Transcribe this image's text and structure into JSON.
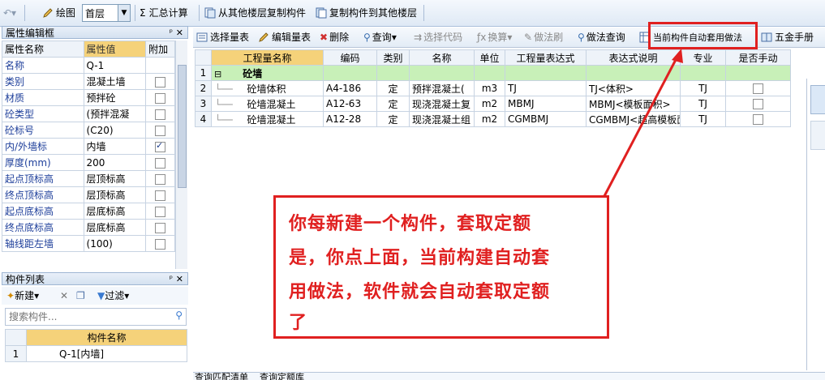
{
  "toolbar": {
    "draw_label": "绘图",
    "floor_value": "首层",
    "sum_label": "汇总计算",
    "copy_from_label": "从其他楼层复制构件",
    "copy_to_label": "复制构件到其他楼层"
  },
  "prop_panel": {
    "title": "属性编辑框",
    "headers": [
      "属性名称",
      "属性值",
      "附加"
    ],
    "rows": [
      {
        "name": "名称",
        "value": "Q-1",
        "has_check": false,
        "checked": false
      },
      {
        "name": "类别",
        "value": "混凝土墙",
        "has_check": true,
        "checked": false
      },
      {
        "name": "材质",
        "value": "预拌砼",
        "has_check": true,
        "checked": false
      },
      {
        "name": "砼类型",
        "value": "(预拌混凝",
        "has_check": true,
        "checked": false
      },
      {
        "name": "砼标号",
        "value": "(C20)",
        "has_check": true,
        "checked": false
      },
      {
        "name": "内/外墙标",
        "value": "内墙",
        "has_check": true,
        "checked": true
      },
      {
        "name": "厚度(mm)",
        "value": "200",
        "has_check": true,
        "checked": false
      },
      {
        "name": "起点顶标高",
        "value": "层顶标高",
        "has_check": true,
        "checked": false
      },
      {
        "name": "终点顶标高",
        "value": "层顶标高",
        "has_check": true,
        "checked": false
      },
      {
        "name": "起点底标高",
        "value": "层底标高",
        "has_check": true,
        "checked": false
      },
      {
        "name": "终点底标高",
        "value": "层底标高",
        "has_check": true,
        "checked": false
      },
      {
        "name": "轴线距左墙",
        "value": "(100)",
        "has_check": true,
        "checked": false
      }
    ]
  },
  "comp_panel": {
    "title": "构件列表",
    "new_label": "新建",
    "filter_label": "过滤",
    "search_placeholder": "搜索构件...",
    "header": "构件名称",
    "items": [
      {
        "num": "1",
        "name": "Q-1[内墙]"
      }
    ]
  },
  "quota_toolbar": {
    "select_table": "选择量表",
    "edit_table": "编辑量表",
    "delete": "删除",
    "query": "查询",
    "select_code": "选择代码",
    "convert": "换算",
    "method_brush": "做法刷",
    "method_query": "做法查询",
    "auto_apply": "当前构件自动套用做法",
    "hardware": "五金手册"
  },
  "quota_table": {
    "headers": [
      "工程量名称",
      "编码",
      "类别",
      "名称",
      "单位",
      "工程量表达式",
      "表达式说明",
      "专业",
      "是否手动"
    ],
    "group": {
      "num": "1",
      "toggle": "⊟",
      "name": "砼墙"
    },
    "rows": [
      {
        "num": "2",
        "qty_name": "砼墙体积",
        "code": "A4-186",
        "type": "定",
        "name": "预拌混凝土(",
        "unit": "m3",
        "expr": "TJ",
        "desc": "TJ<体积>",
        "major": "TJ"
      },
      {
        "num": "3",
        "qty_name": "砼墙混凝土",
        "code": "A12-63",
        "type": "定",
        "name": "现浇混凝土复",
        "unit": "m2",
        "expr": "MBMJ",
        "desc": "MBMJ<模板面积>",
        "major": "TJ"
      },
      {
        "num": "4",
        "qty_name": "砼墙混凝土",
        "code": "A12-28",
        "type": "定",
        "name": "现浇混凝土组",
        "unit": "m2",
        "expr": "CGMBMJ",
        "desc": "CGMBMJ<超高模板面积",
        "major": "TJ"
      }
    ]
  },
  "annotation": {
    "lines": [
      "你每新建一个构件，套取定额",
      "是，你点上面，当前构建自动套",
      "用做法，软件就会自动套取定额",
      "了"
    ]
  },
  "bottom_tabs": {
    "tab1": "查询匹配清单",
    "tab2": "查询定额库"
  },
  "colors": {
    "highlight_header": "#f5d27a",
    "group_row": "#c8f0b8",
    "annotation_red": "#e02020"
  }
}
